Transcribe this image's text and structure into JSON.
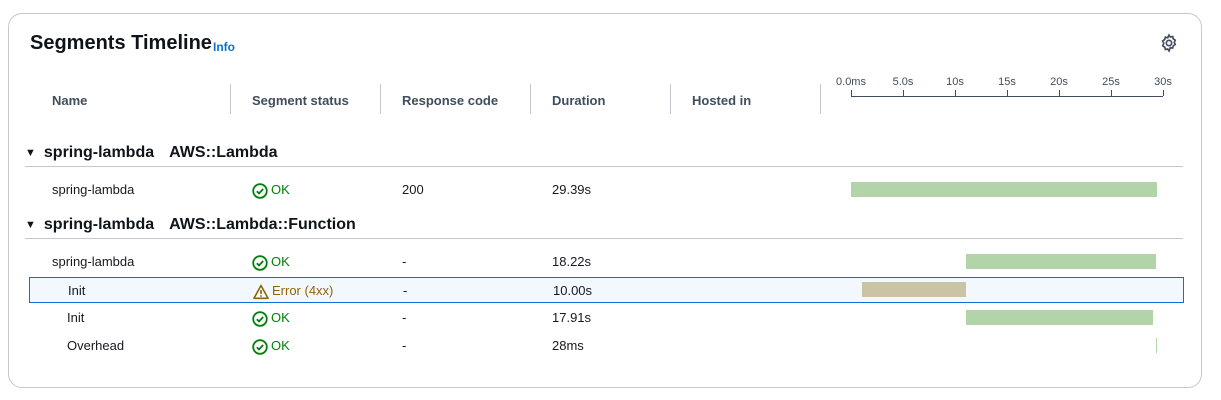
{
  "panel": {
    "title": "Segments Timeline",
    "info_link": "Info",
    "settings_icon": "gear-icon"
  },
  "columns": {
    "name": "Name",
    "segment_status": "Segment status",
    "response_code": "Response code",
    "duration": "Duration",
    "hosted_in": "Hosted in"
  },
  "timeline_axis": {
    "ticks": [
      "0.0ms",
      "5.0s",
      "10s",
      "15s",
      "20s",
      "25s",
      "30s"
    ],
    "tick_values_s": [
      0,
      5,
      10,
      15,
      20,
      25,
      30
    ],
    "max_s": 30
  },
  "colors": {
    "ok_bar": "#b2d4a8",
    "error_bar": "#cbc3a5",
    "ok_text": "#037f0c",
    "error_text": "#8d6605",
    "selected_border": "#0972d3",
    "link": "#0972d3"
  },
  "groups": [
    {
      "name": "spring-lambda",
      "type": "AWS::Lambda",
      "rows": [
        {
          "name": "spring-lambda",
          "indent": 0,
          "status": "OK",
          "status_kind": "ok",
          "response_code": "200",
          "duration": "29.39s",
          "hosted_in": "",
          "bar_start_s": 0.0,
          "bar_end_s": 29.39,
          "selected": false
        }
      ]
    },
    {
      "name": "spring-lambda",
      "type": "AWS::Lambda::Function",
      "rows": [
        {
          "name": "spring-lambda",
          "indent": 0,
          "status": "OK",
          "status_kind": "ok",
          "response_code": "-",
          "duration": "18.22s",
          "hosted_in": "",
          "bar_start_s": 11.1,
          "bar_end_s": 29.32,
          "selected": false
        },
        {
          "name": "Init",
          "indent": 1,
          "status": "Error (4xx)",
          "status_kind": "error",
          "response_code": "-",
          "duration": "10.00s",
          "hosted_in": "",
          "bar_start_s": 1.1,
          "bar_end_s": 11.1,
          "selected": true
        },
        {
          "name": "Init",
          "indent": 1,
          "status": "OK",
          "status_kind": "ok",
          "response_code": "-",
          "duration": "17.91s",
          "hosted_in": "",
          "bar_start_s": 11.1,
          "bar_end_s": 29.01,
          "selected": false
        },
        {
          "name": "Overhead",
          "indent": 1,
          "status": "OK",
          "status_kind": "ok",
          "response_code": "-",
          "duration": "28ms",
          "hosted_in": "",
          "bar_start_s": 29.32,
          "bar_end_s": 29.348,
          "selected": false
        }
      ]
    }
  ]
}
